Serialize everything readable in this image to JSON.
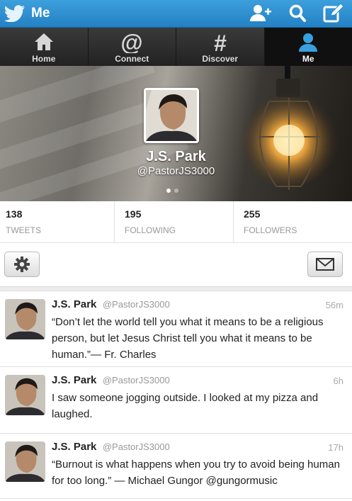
{
  "topbar": {
    "title": "Me",
    "icons": [
      "bird-logo-icon",
      "add-user-icon",
      "search-icon",
      "compose-icon"
    ]
  },
  "nav": {
    "tabs": [
      {
        "label": "Home",
        "icon": "home-icon"
      },
      {
        "label": "Connect",
        "icon": "at-icon"
      },
      {
        "label": "Discover",
        "icon": "hash-icon"
      },
      {
        "label": "Me",
        "icon": "person-icon",
        "active": true
      }
    ]
  },
  "profile": {
    "name": "J.S. Park",
    "handle": "@PastorJS3000"
  },
  "stats": [
    {
      "count": "138",
      "label": "TWEETS"
    },
    {
      "count": "195",
      "label": "FOLLOWING"
    },
    {
      "count": "255",
      "label": "FOLLOWERS"
    }
  ],
  "tweets": [
    {
      "name": "J.S. Park",
      "handle": "@PastorJS3000",
      "time": "56m",
      "text": "“Don’t let the world tell you what it means to be a religious person, but let Jesus Christ tell you what it means to be human.”— Fr. Charles"
    },
    {
      "name": "J.S. Park",
      "handle": "@PastorJS3000",
      "time": "6h",
      "text": "I saw someone jogging outside. I looked at my pizza and laughed."
    },
    {
      "name": "J.S. Park",
      "handle": "@PastorJS3000",
      "time": "17h",
      "text": "“Burnout is what happens when you try to avoid being human for too long.” — Michael Gungor @gungormusic"
    }
  ],
  "colors": {
    "topbar": "#2b8dd0",
    "nav": "#222222",
    "accent": "#39a0e0"
  }
}
